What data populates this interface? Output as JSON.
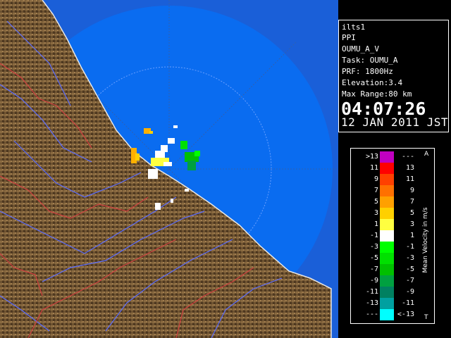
{
  "info": {
    "site": "ilts1",
    "product": "PPI",
    "task_name": "OUMU_A_V",
    "task": "Task: OUMU_A",
    "prf": "PRF: 1800Hz",
    "elevation": "Elevation:3.4",
    "max_range": "Max Range:80 km",
    "time": "04:07:26",
    "date": "12 JAN 2011 JST"
  },
  "legend": {
    "title": "Mean Velocity in m/s",
    "top_marker": "A",
    "bottom_marker": "T",
    "rows": [
      {
        "lo": ">13",
        "hi": "---",
        "color": "#c000c0"
      },
      {
        "lo": "11",
        "hi": "13",
        "color": "#ff0000"
      },
      {
        "lo": "9",
        "hi": "11",
        "color": "#ff4000"
      },
      {
        "lo": "7",
        "hi": "9",
        "color": "#ff7000"
      },
      {
        "lo": "5",
        "hi": "7",
        "color": "#ffa000"
      },
      {
        "lo": "3",
        "hi": "5",
        "color": "#ffd000"
      },
      {
        "lo": "1",
        "hi": "3",
        "color": "#ffff40"
      },
      {
        "lo": "-1",
        "hi": "1",
        "color": "#ffffff"
      },
      {
        "lo": "-3",
        "hi": "-1",
        "color": "#00ff00"
      },
      {
        "lo": "-5",
        "hi": "-3",
        "color": "#00e000"
      },
      {
        "lo": "-7",
        "hi": "-5",
        "color": "#00c000"
      },
      {
        "lo": "-9",
        "hi": "-7",
        "color": "#00a040"
      },
      {
        "lo": "-11",
        "hi": "-9",
        "color": "#008060"
      },
      {
        "lo": "-13",
        "hi": "-11",
        "color": "#00a0a0"
      },
      {
        "lo": "---",
        "hi": "<-13",
        "color": "#00ffff"
      }
    ]
  },
  "colors": {
    "sea": "#0a6cf0",
    "outer_ring": "#1a5fd8",
    "land": "#6b4f2e",
    "rivers": "#5a6cff",
    "boundaries": "#d04040"
  }
}
